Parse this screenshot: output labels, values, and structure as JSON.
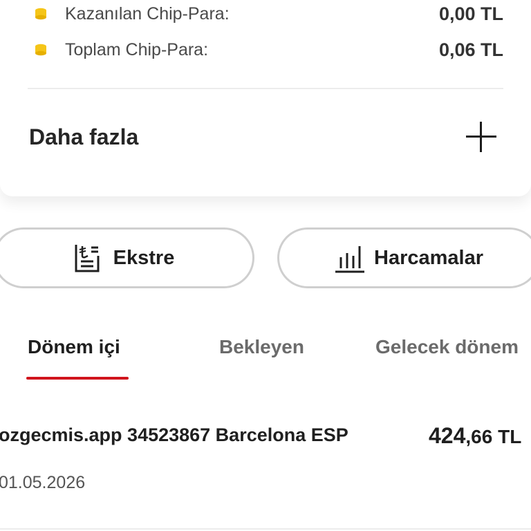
{
  "summary": {
    "earned_label": "Kazanılan Chip-Para:",
    "earned_value": "0,00 TL",
    "total_label": "Toplam Chip-Para:",
    "total_value": "0,06 TL",
    "more_label": "Daha fazla",
    "coin_color": "#f5c518"
  },
  "actions": {
    "statement_label": "Ekstre",
    "spending_label": "Harcamalar",
    "statement_icon": "statement-icon",
    "spending_icon": "bar-chart-icon"
  },
  "tabs": [
    {
      "label": "Dönem içi",
      "active": true
    },
    {
      "label": "Bekleyen",
      "active": false
    },
    {
      "label": "Gelecek dönem",
      "active": false
    }
  ],
  "accent_color": "#d0141d",
  "transactions": [
    {
      "description": "ozgecmis.app 34523867 Barcelona ESP",
      "amount_integer": "424",
      "amount_decimal": ",66 TL",
      "date": "01.05.2026"
    }
  ]
}
